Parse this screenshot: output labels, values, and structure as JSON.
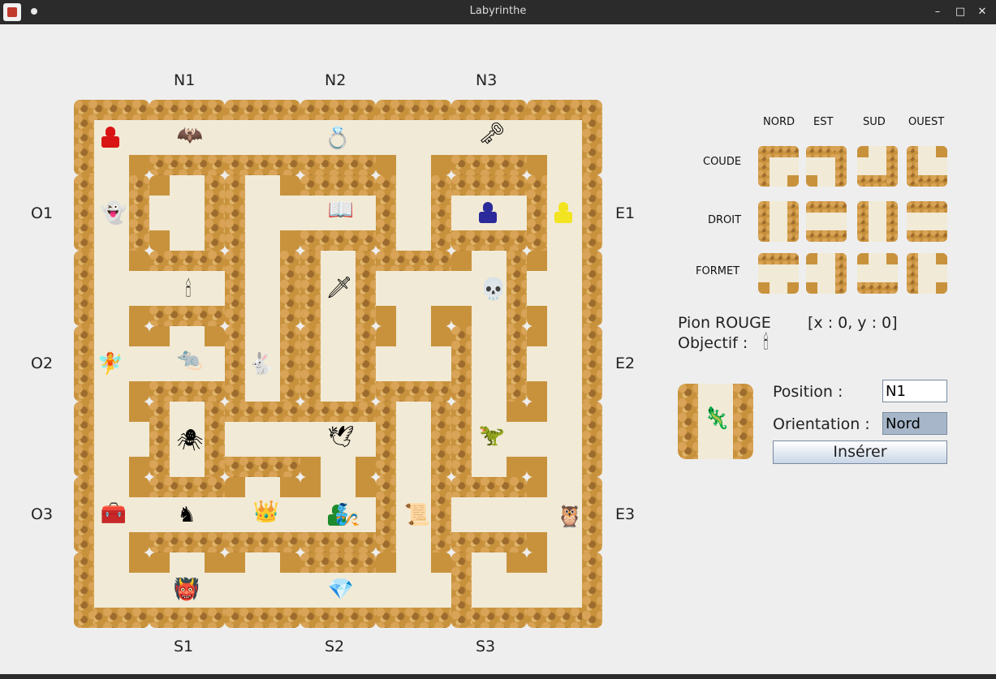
{
  "window": {
    "title": "Labyrinthe",
    "minimize": "–",
    "maximize": "□",
    "close": "✕"
  },
  "board": {
    "top_labels": [
      "N1",
      "N2",
      "N3"
    ],
    "bottom_labels": [
      "S1",
      "S2",
      "S3"
    ],
    "left_labels": [
      "O1",
      "O2",
      "O3"
    ],
    "right_labels": [
      "E1",
      "E2",
      "E3"
    ],
    "objects": {
      "bat": "🦇",
      "ring": "💍",
      "key": "🗝",
      "ghost": "👻",
      "book": "📖",
      "candelabra": "🕯",
      "sword": "🗡",
      "skull": "💀",
      "fairy": "🧚",
      "rat": "🐀",
      "rabbit": "🐇",
      "spider": "🕷",
      "dove": "🕊",
      "dinosaur": "🦖",
      "chest": "🧰",
      "knight": "♞",
      "crown": "👑",
      "genie": "🧞",
      "scroll": "📜",
      "owl": "🦉",
      "troll": "👹",
      "emerald": "💎"
    }
  },
  "panel": {
    "orientations": [
      "NORD",
      "EST",
      "SUD",
      "OUEST"
    ],
    "tile_types": [
      "COUDE",
      "DROIT",
      "FORMET"
    ],
    "player": "Pion ROUGE",
    "coords": "[x : 0,  y : 0]",
    "objective_label": "Objectif :",
    "objective_icon": "🕯",
    "current_tile_object": "🦎",
    "position_label": "Position :",
    "position_value": "N1",
    "orientation_label": "Orientation :",
    "orientation_value": "Nord",
    "insert_button": "Insérer"
  }
}
